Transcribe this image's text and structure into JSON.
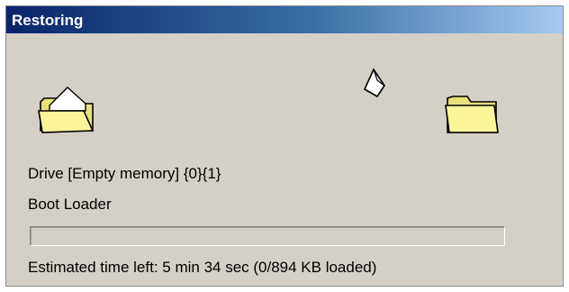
{
  "window": {
    "title": "Restoring"
  },
  "status": {
    "drive": "Drive [Empty memory] {0}{1}",
    "current_file": "Boot Loader",
    "estimate": "Estimated time left: 5 min 34 sec (0/894 KB loaded)"
  },
  "progress": {
    "fraction": 0
  },
  "icons": {
    "source": "open-folder-icon",
    "transfer": "flying-document-icon",
    "destination": "folder-icon"
  },
  "colors": {
    "titlebar_start": "#0a246a",
    "titlebar_end": "#a6caf0",
    "folder_fill": "#fbf59a",
    "dialog_bg": "#d4d0c8"
  }
}
